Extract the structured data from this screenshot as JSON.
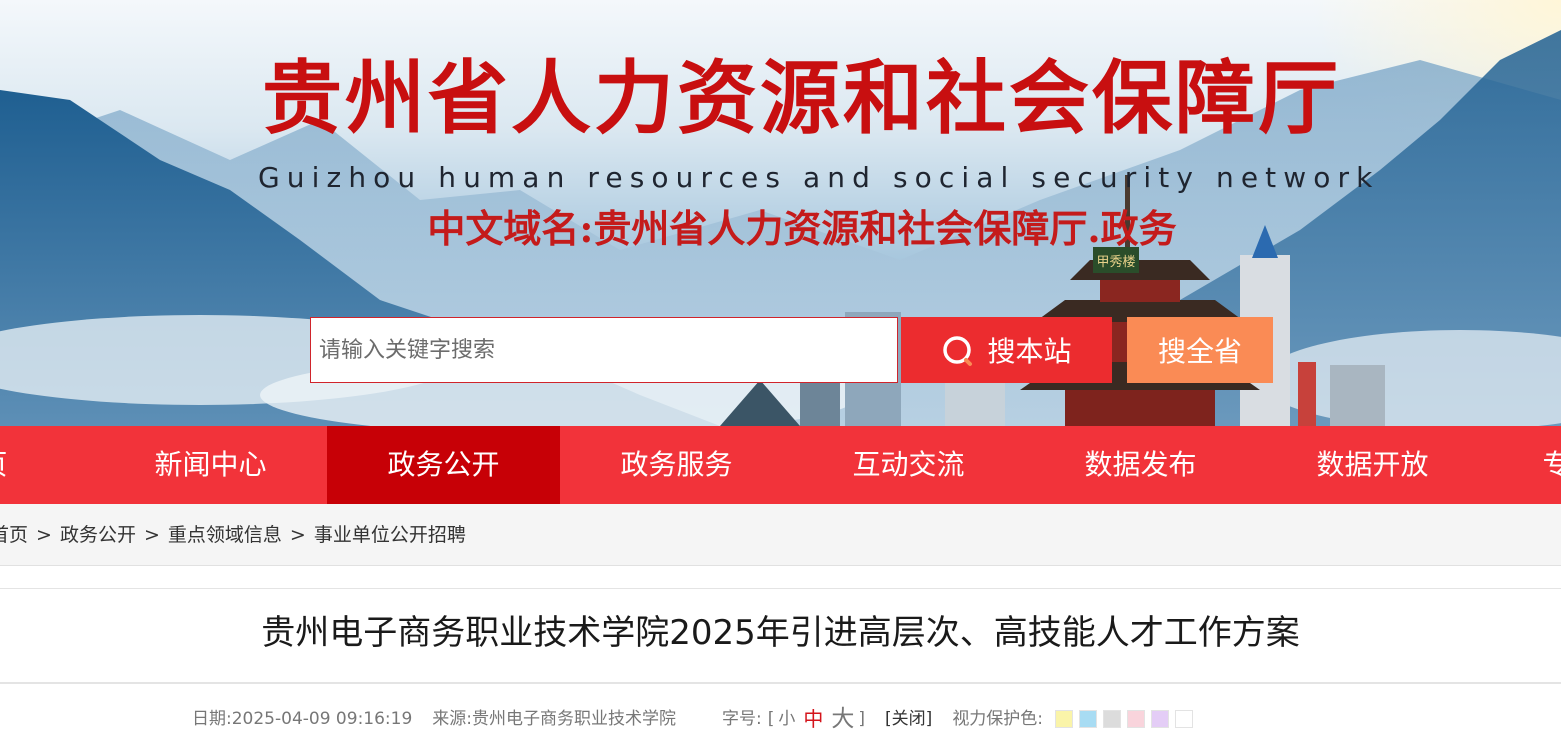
{
  "header": {
    "title": "贵州省人力资源和社会保障厅",
    "subtitle_en": "Guizhou human resources and social security network",
    "domain_line": "中文域名:贵州省人力资源和社会保障厅.政务",
    "tower_sign": "甲秀楼"
  },
  "search": {
    "placeholder": "请输入关键字搜索",
    "site_button": "搜本站",
    "province_button": "搜全省"
  },
  "nav": {
    "items": [
      {
        "label": "首页"
      },
      {
        "label": "新闻中心"
      },
      {
        "label": "政务公开"
      },
      {
        "label": "政务服务"
      },
      {
        "label": "互动交流"
      },
      {
        "label": "数据发布"
      },
      {
        "label": "数据开放"
      },
      {
        "label": "专"
      }
    ],
    "active_index": 2
  },
  "breadcrumb": {
    "items": [
      "首页",
      "政务公开",
      "重点领域信息",
      "事业单位公开招聘"
    ],
    "separator": ">"
  },
  "article": {
    "title": "贵州电子商务职业技术学院2025年引进高层次、高技能人才工作方案",
    "date_label": "日期:",
    "date": "2025-04-09 09:16:19",
    "source_label": "来源:",
    "source": "贵州电子商务职业技术学院",
    "font_label": "字号:",
    "bracket_open": "[",
    "bracket_close": "]",
    "font_small": "小",
    "font_mid": "中",
    "font_large": "大",
    "close_label": "[关闭]",
    "eye_care_label": "视力保护色:",
    "eye_care_colors": [
      "#faf4a9",
      "#a8dcf3",
      "#dcdcdc",
      "#f9d4dc",
      "#e4cdf6",
      "#ffffff"
    ]
  },
  "colors": {
    "brand_red": "#f2333a",
    "nav_active": "#c70006",
    "search_site_bg": "#ec2c2f",
    "search_province_bg": "#fa8b55",
    "title_red": "#c80f10"
  }
}
